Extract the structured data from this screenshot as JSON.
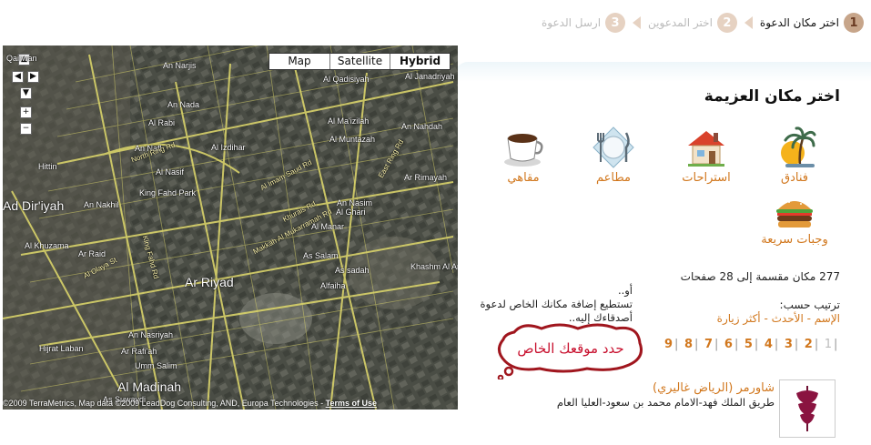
{
  "steps": [
    {
      "num": "1",
      "label": "اختر مكان الدعوة",
      "active": true
    },
    {
      "num": "2",
      "label": "اختر المدعوين",
      "active": false
    },
    {
      "num": "3",
      "label": "ارسل الدعوة",
      "active": false
    }
  ],
  "panel": {
    "title": "اختر مكان العزيمة"
  },
  "categories": [
    {
      "label": "فنادق",
      "icon": "palm-tree-icon"
    },
    {
      "label": "استراحات",
      "icon": "house-icon"
    },
    {
      "label": "مطاعم",
      "icon": "fork-knife-plate-icon"
    },
    {
      "label": "مقاهي",
      "icon": "coffee-cup-icon"
    },
    {
      "label": "وجبات سريعة",
      "icon": "burger-icon"
    }
  ],
  "listing": {
    "count_text": "277 مكان مقسمة إلى 28 صفحات",
    "sort_label": "ترتيب حسب:",
    "sort_options": [
      "الإسم",
      "الأحدث",
      "أكثر زيارة"
    ],
    "sort_separator": " - ",
    "pages": [
      "1",
      "2",
      "3",
      "4",
      "5",
      "6",
      "7",
      "8",
      "9"
    ],
    "current_page": "1"
  },
  "hint": {
    "or_text": "أو..",
    "line": "تستطيع إضافة مكانك الخاص لدعوة أصدقاءك إليه.."
  },
  "custom_location_button": "حدد موقعك الخاص",
  "result": {
    "name": "شاورمر (الرياض غاليري)",
    "address": "طريق الملك فهد-الامام محمد بن سعود-العليا العام"
  },
  "map": {
    "types": [
      "Map",
      "Satellite",
      "Hybrid"
    ],
    "selected_type": "Hybrid",
    "labels": {
      "qairwan": "Qairwan",
      "an_narjis": "An Narjis",
      "al_qadisiyah": "Al Qadisiyah",
      "al_janadriyah": "Al Janadriyah",
      "an_nada": "An Nada",
      "al_rabi": "Al Rabi",
      "al_maizilah": "Al Ma'izilah",
      "an_nahdah": "An Nahdah",
      "al_izdihar": "Al Izdihar",
      "an_nafl": "An Nafl",
      "al_muntazah": "Al Muntazah",
      "hittin": "Hittin",
      "al_nasif": "Al Nasif",
      "ar_rimayah": "Ar Rimayah",
      "an_nakhil": "An Nakhil",
      "king_fahd_park": "King Fahd Park",
      "an_nasim": "An Nasim",
      "al_ghari": "Al Ghari",
      "ad_diriyah": "Ad Dir'iyah",
      "al_manar": "Al Manar",
      "al_khuzama": "Al Khuzama",
      "ar_raid": "Ar Raid",
      "as_salam": "As Salam",
      "khashm_al_aan": "Khashm Al An",
      "as_sadah": "As sadah",
      "ar_riyad": "Ar Riyad",
      "alfaiha": "Alfaiha",
      "an_nasriyah": "An Nasriyah",
      "hijrat_laban": "Hijrat Laban",
      "ar_rafiah": "Ar Rafi'ah",
      "umm_salim": "Umm Salim",
      "al_madinah": "Al Madinah",
      "as_suwaydi": "As Suwaydi",
      "rd_north_ring": "North Ring Rd",
      "rd_king_fahd": "King Fahd Rd",
      "rd_olaya": "Al Olaya St",
      "rd_khurais": "Khurais Rd",
      "rd_imam": "Al Imam Saud Rd",
      "rd_east_ring": "East Ring Rd",
      "rd_makkah": "Makkah Al Mukarramah Rd"
    },
    "copyright": "©2009 TerraMetrics, Map data ©2009 LeadDog Consulting, AND, Europa Technologies - ",
    "terms": "Terms of Use"
  },
  "colors": {
    "accent": "#d1771d",
    "step_circle": "#c7a58a",
    "error_red": "#c8102e"
  }
}
